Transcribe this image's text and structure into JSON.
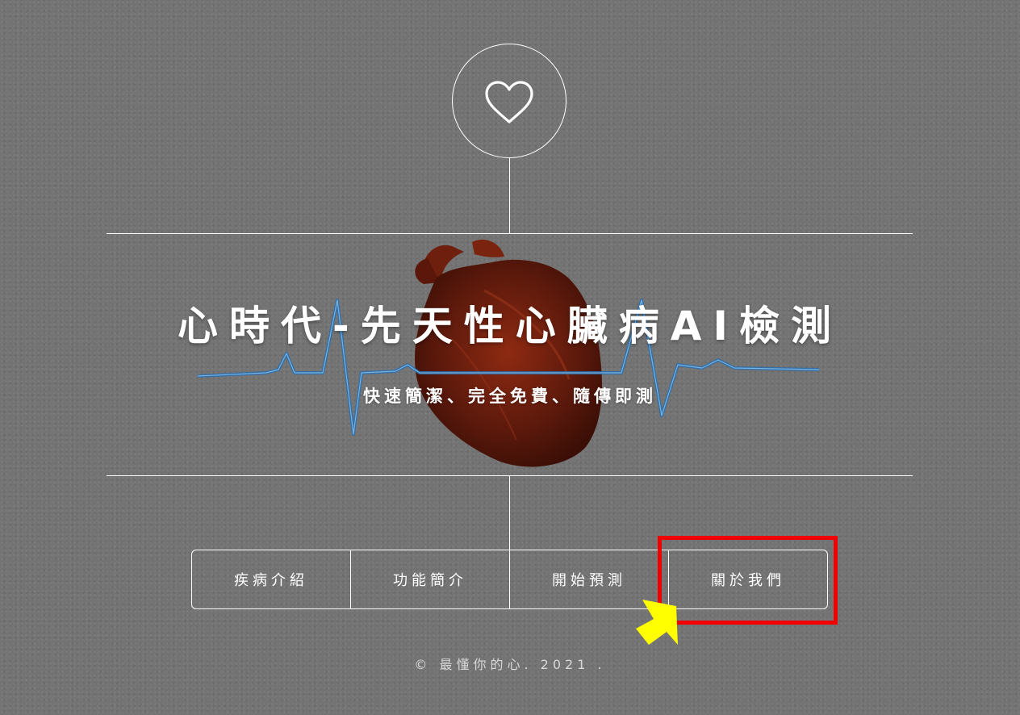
{
  "header": {
    "icon": "heart-outline-icon"
  },
  "hero": {
    "title": "心時代-先天性心臟病AI檢測",
    "subtitle": "快速簡潔、完全免費、隨傳即測"
  },
  "nav": {
    "items": [
      {
        "label": "疾病介紹"
      },
      {
        "label": "功能簡介"
      },
      {
        "label": "開始預測"
      },
      {
        "label": "關於我們"
      }
    ]
  },
  "annotation": {
    "highlight_color": "#f00000",
    "cursor_color": "#ffff00"
  },
  "footer": {
    "text": "© 最懂你的心. 2021 ."
  }
}
